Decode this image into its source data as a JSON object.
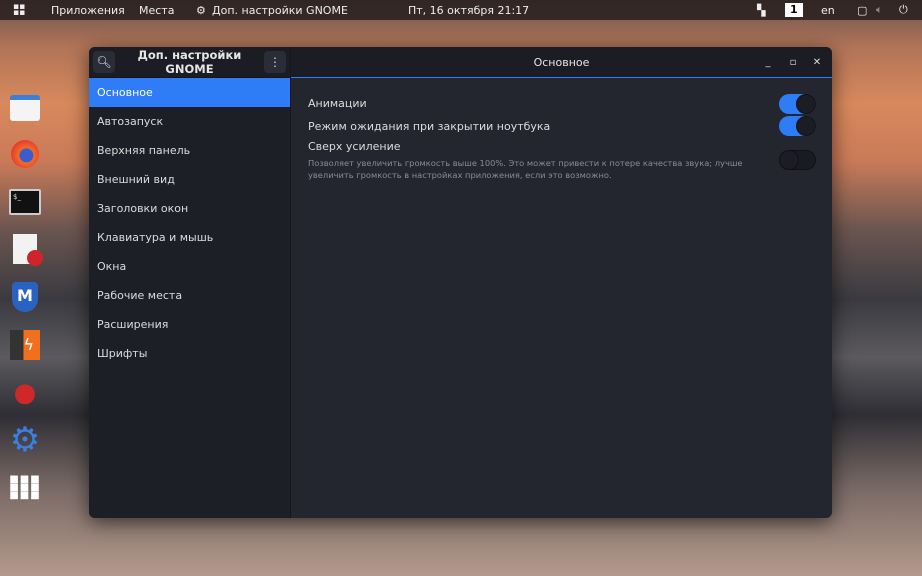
{
  "topbar": {
    "activities_icon": "grid-icon",
    "apps": "Приложения",
    "places": "Места",
    "app_menu_icon": "gear-icon",
    "app_menu": "Доп. настройки GNOME",
    "clock": "Пт, 16 октября  21:17",
    "workspace": "1",
    "keyboard_layout": "en",
    "status_icons": [
      "window-icon",
      "volume-icon",
      "power-icon"
    ]
  },
  "dock": [
    "files-icon",
    "firefox-icon",
    "terminal-icon",
    "text-editor-icon",
    "metasploit-icon",
    "burpsuite-icon",
    "cherrytree-icon",
    "settings-icon",
    "app-grid-icon"
  ],
  "window": {
    "sidebar_title": "Доп. настройки GNOME",
    "title": "Основное",
    "sidebar": [
      {
        "label": "Основное",
        "active": true
      },
      {
        "label": "Автозапуск"
      },
      {
        "label": "Верхняя панель"
      },
      {
        "label": "Внешний вид"
      },
      {
        "label": "Заголовки окон"
      },
      {
        "label": "Клавиатура и мышь"
      },
      {
        "label": "Окна"
      },
      {
        "label": "Рабочие места"
      },
      {
        "label": "Расширения"
      },
      {
        "label": "Шрифты"
      }
    ],
    "settings": [
      {
        "label": "Анимации",
        "on": true
      },
      {
        "label": "Режим ожидания при закрытии ноутбука",
        "on": true
      },
      {
        "label": "Сверх усиление",
        "on": false,
        "description": "Позволяет увеличить громкость выше 100%. Это может привести к потере качества звука; лучше увеличить громкость в настройках приложения, если это возможно."
      }
    ]
  },
  "colors": {
    "accent": "#2e7cf6"
  }
}
